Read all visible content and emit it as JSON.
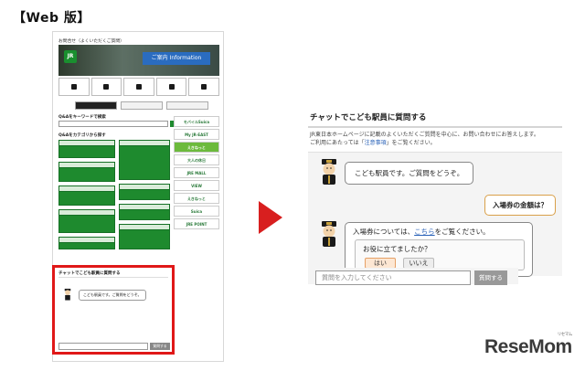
{
  "page_label": "【Web 版】",
  "mini_page": {
    "breadcrumb": "お問合せ（よくいただくご質問）",
    "banner_jr": "JR",
    "banner_info": "ご案内 Information",
    "qa_search_title": "Q&Aをキーワードで検索",
    "category_title": "Q&Aをカテゴリから探す",
    "side_links": [
      "モバイルSuica",
      "My JR-EAST",
      "えきねっと",
      "大人の休日",
      "JRE MALL",
      "VIEW",
      "えきねっと",
      "Suica",
      "JRE POINT"
    ],
    "chat_title": "チャットでこども駅員に質問する",
    "chat_message": "こども駅員です。ご質問をどうぞ。",
    "chat_input_placeholder": "",
    "chat_send": "質問する"
  },
  "chat_panel": {
    "title": "チャットでこども駅員に質問する",
    "note_line1": "JR東日本ホームページに記載のよくいただくご質問を中心に、お問い合わせにお答えします。",
    "note_line2_prefix": "ご利用にあたっては「",
    "note_link": "注意事項",
    "note_line2_suffix": "」をご覧ください。",
    "bot_greeting": "こども駅員です。ご質問をどうぞ。",
    "user_question": "入場券の金額は？",
    "bot_answer_prefix": "入場券については、",
    "bot_answer_link": "こちら",
    "bot_answer_suffix": "をご覧ください。",
    "feedback_question": "お役に立てましたか？",
    "feedback_yes": "はい",
    "feedback_no": "いいえ",
    "input_placeholder": "質問を入力してください",
    "send_button": "質問する"
  },
  "logo": {
    "name": "ReseMom",
    "sub": "リセマム"
  },
  "colors": {
    "jr_green": "#1e8a2e",
    "highlight_red": "#e01818",
    "arrow_red": "#d81f1f",
    "link_blue": "#2a62b8",
    "user_bubble_border": "#d9a04a"
  }
}
